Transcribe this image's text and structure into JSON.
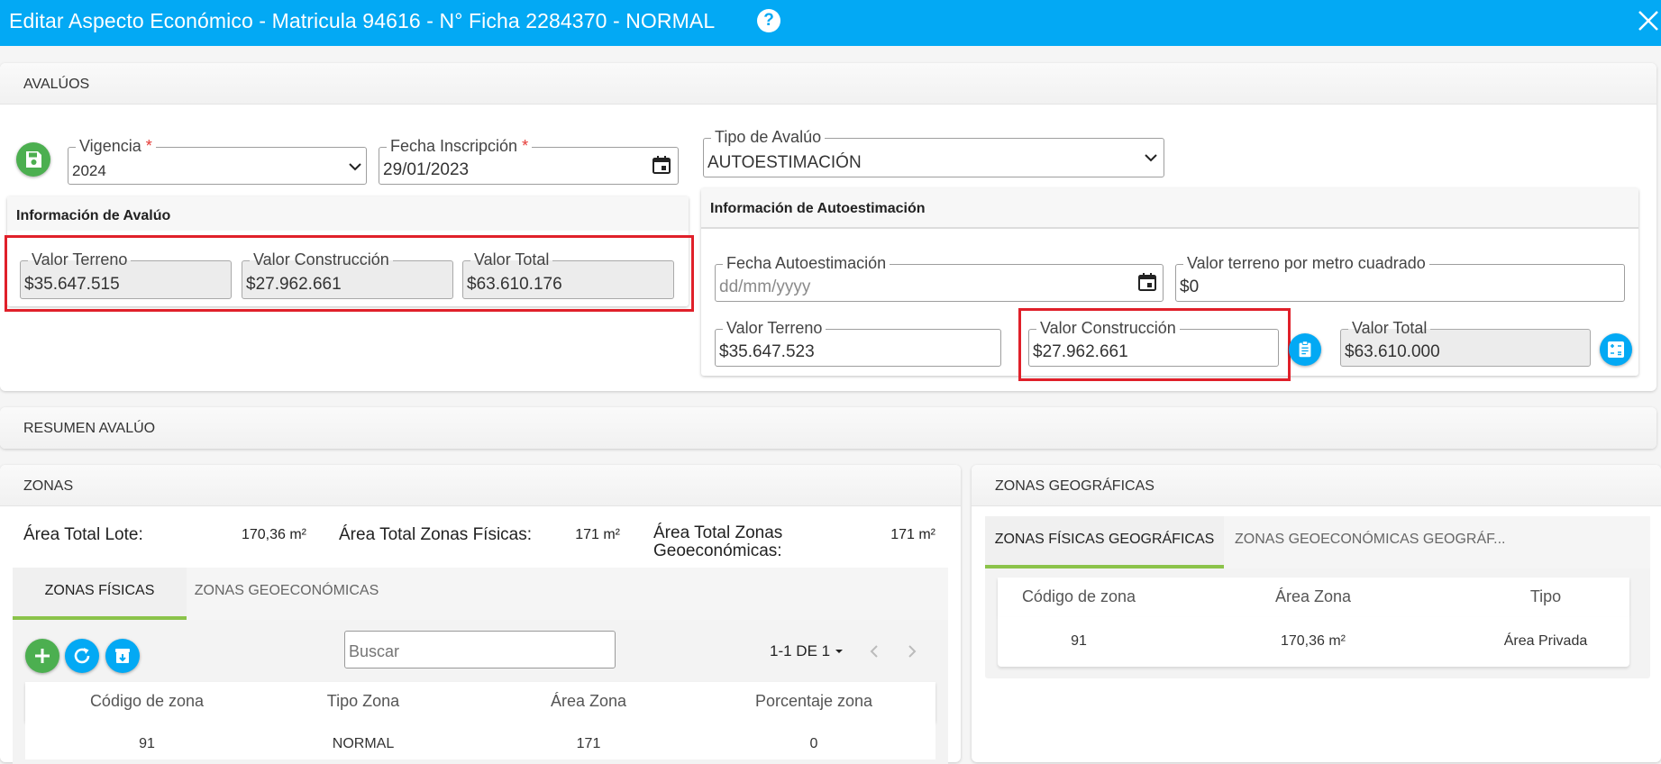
{
  "header": {
    "title": "Editar Aspecto Económico - Matricula 94616 - N° Ficha 2284370 - NORMAL",
    "help_icon": "?"
  },
  "avaluos": {
    "section_title": "AVALÚOS",
    "vigencia": {
      "label": "Vigencia",
      "required_mark": "*",
      "value": "2024"
    },
    "fecha_inscripcion": {
      "label": "Fecha Inscripción",
      "required_mark": "*",
      "value": "29/01/2023"
    },
    "tipo_avaluo": {
      "label": "Tipo de Avalúo",
      "value": "AUTOESTIMACIÓN"
    },
    "info_avaluo": {
      "title": "Información de Avalúo",
      "valor_terreno": {
        "label": "Valor Terreno",
        "value": "$35.647.515"
      },
      "valor_construccion": {
        "label": "Valor Construcción",
        "value": "$27.962.661"
      },
      "valor_total": {
        "label": "Valor Total",
        "value": "$63.610.176"
      }
    },
    "info_autoestimacion": {
      "title": "Información de Autoestimación",
      "fecha_autoestimacion": {
        "label": "Fecha Autoestimación",
        "placeholder": "dd/mm/yyyy"
      },
      "valor_terreno_m2": {
        "label": "Valor terreno por metro cuadrado",
        "value": "$0"
      },
      "valor_terreno": {
        "label": "Valor Terreno",
        "value": "$35.647.523"
      },
      "valor_construccion": {
        "label": "Valor Construcción",
        "value": "$27.962.661"
      },
      "valor_total": {
        "label": "Valor Total",
        "value": "$63.610.000"
      }
    }
  },
  "resumen": {
    "section_title": "RESUMEN AVALÚO"
  },
  "zonas": {
    "section_title": "ZONAS",
    "area_total_lote": {
      "label": "Área Total Lote:",
      "value": "170,36 m²"
    },
    "area_total_fisicas": {
      "label": "Área Total Zonas Físicas:",
      "value": "171 m²"
    },
    "area_total_geoeconomicas": {
      "label_line1": "Área Total Zonas",
      "label_line2": "Geoeconómicas:",
      "value": "171 m²"
    },
    "tabs": [
      "ZONAS FÍSICAS",
      "ZONAS GEOECONÓMICAS"
    ],
    "search_placeholder": "Buscar",
    "pagination": "1-1 DE 1",
    "columns": [
      "Código de zona",
      "Tipo Zona",
      "Área Zona",
      "Porcentaje zona"
    ],
    "rows": [
      {
        "codigo": "91",
        "tipo": "NORMAL",
        "area": "171",
        "porcentaje": "0"
      }
    ]
  },
  "zonas_geo": {
    "section_title": "ZONAS GEOGRÁFICAS",
    "tabs": [
      "ZONAS FÍSICAS GEOGRÁFICAS",
      "ZONAS GEOECONÓMICAS GEOGRÁF..."
    ],
    "columns": [
      "Código de zona",
      "Área Zona",
      "Tipo"
    ],
    "rows": [
      {
        "codigo": "91",
        "area": "170,36 m²",
        "tipo": "Área Privada"
      }
    ]
  },
  "colors": {
    "header": "#03a9f4",
    "accent_green": "#4caf50",
    "accent_blue": "#03a9f4",
    "highlight_red": "#e0202a",
    "tab_underline": "#8bc34a"
  },
  "icons": {
    "save": "floppy-disk-icon",
    "help": "question-mark-icon",
    "close": "close-icon",
    "calendar": "calendar-icon",
    "clipboard": "clipboard-icon",
    "calculator": "calculator-icon",
    "add": "plus-icon",
    "refresh": "refresh-icon",
    "archive": "archive-download-icon"
  }
}
